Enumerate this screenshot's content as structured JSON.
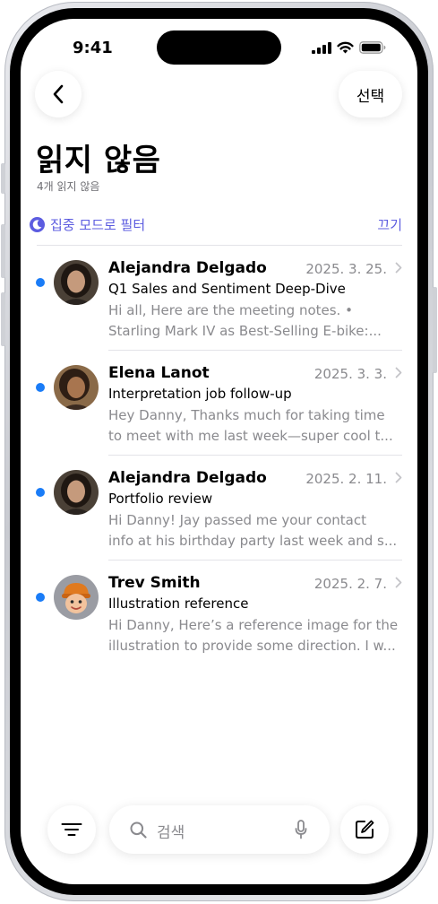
{
  "status_bar": {
    "time": "9:41"
  },
  "toolbar": {
    "back_icon": "chevron-left-icon",
    "select_label": "선택"
  },
  "header": {
    "title": "읽지 않음",
    "subtitle": "4개 읽지 않음"
  },
  "filter": {
    "icon": "moon-icon",
    "label": "집중 모드로 필터",
    "off_label": "끄기",
    "accent_color": "#5c5ce0"
  },
  "unread_color": "#1a7cf7",
  "mails": [
    {
      "sender": "Alejandra Delgado",
      "date": "2025. 3. 25.",
      "subject": "Q1 Sales and Sentiment Deep-Dive",
      "preview_line1": "Hi all, Here are the meeting notes. •",
      "preview_line2": "Starling Mark IV as Best-Selling E-bike:...",
      "avatar": "avatar-photo-alejandra"
    },
    {
      "sender": "Elena Lanot",
      "date": "2025. 3. 3.",
      "subject": "Interpretation job follow-up",
      "preview_line1": "Hey Danny, Thanks much for taking time",
      "preview_line2": "to meet with me last week—super cool t...",
      "avatar": "avatar-photo-elena"
    },
    {
      "sender": "Alejandra Delgado",
      "date": "2025. 2. 11.",
      "subject": "Portfolio review",
      "preview_line1": "Hi Danny! Jay passed me your contact",
      "preview_line2": "info at his birthday party last week and s...",
      "avatar": "avatar-photo-alejandra"
    },
    {
      "sender": "Trev Smith",
      "date": "2025. 2. 7.",
      "subject": "Illustration reference",
      "preview_line1": "Hi Danny, Here’s a reference image for the",
      "preview_line2": "illustration to provide some direction. I w...",
      "avatar": "avatar-memoji-trev"
    }
  ],
  "bottom_bar": {
    "filter_icon": "filter-lines-icon",
    "search_placeholder": "검색",
    "search_icon": "magnifier-icon",
    "mic_icon": "microphone-icon",
    "compose_icon": "compose-icon"
  }
}
